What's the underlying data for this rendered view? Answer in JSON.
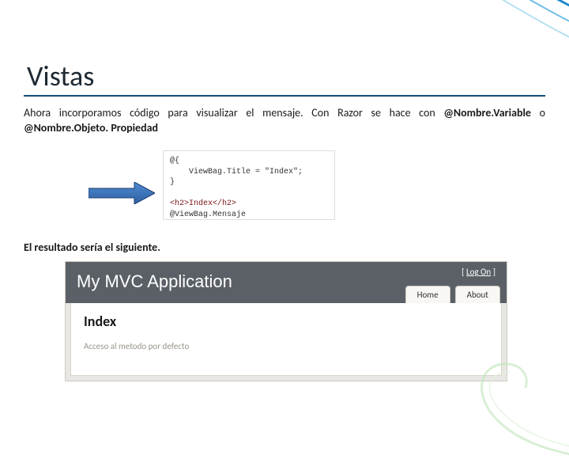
{
  "slide": {
    "title": "Vistas",
    "intro_pre": "Ahora incorporamos código para visualizar el mensaje. Con Razor se hace con ",
    "intro_bold1": "@Nombre.Variable",
    "intro_mid": " o ",
    "intro_bold2": "@Nombre.Objeto. Propiedad",
    "result_label": "El resultado sería el siguiente."
  },
  "code": {
    "l1": "@{",
    "l2": "    ViewBag.Title = \"Index\";",
    "l3": "}",
    "l4": "",
    "l5": "<h2>Index</h2>",
    "l6": "@ViewBag.Mensaje"
  },
  "mvc": {
    "app_title": "My MVC Application",
    "logon_open": "[ ",
    "logon_link": "Log On",
    "logon_close": " ]",
    "tabs": {
      "home": "Home",
      "about": "About"
    },
    "page_heading": "Index",
    "message": "Acceso al metodo por defecto"
  }
}
